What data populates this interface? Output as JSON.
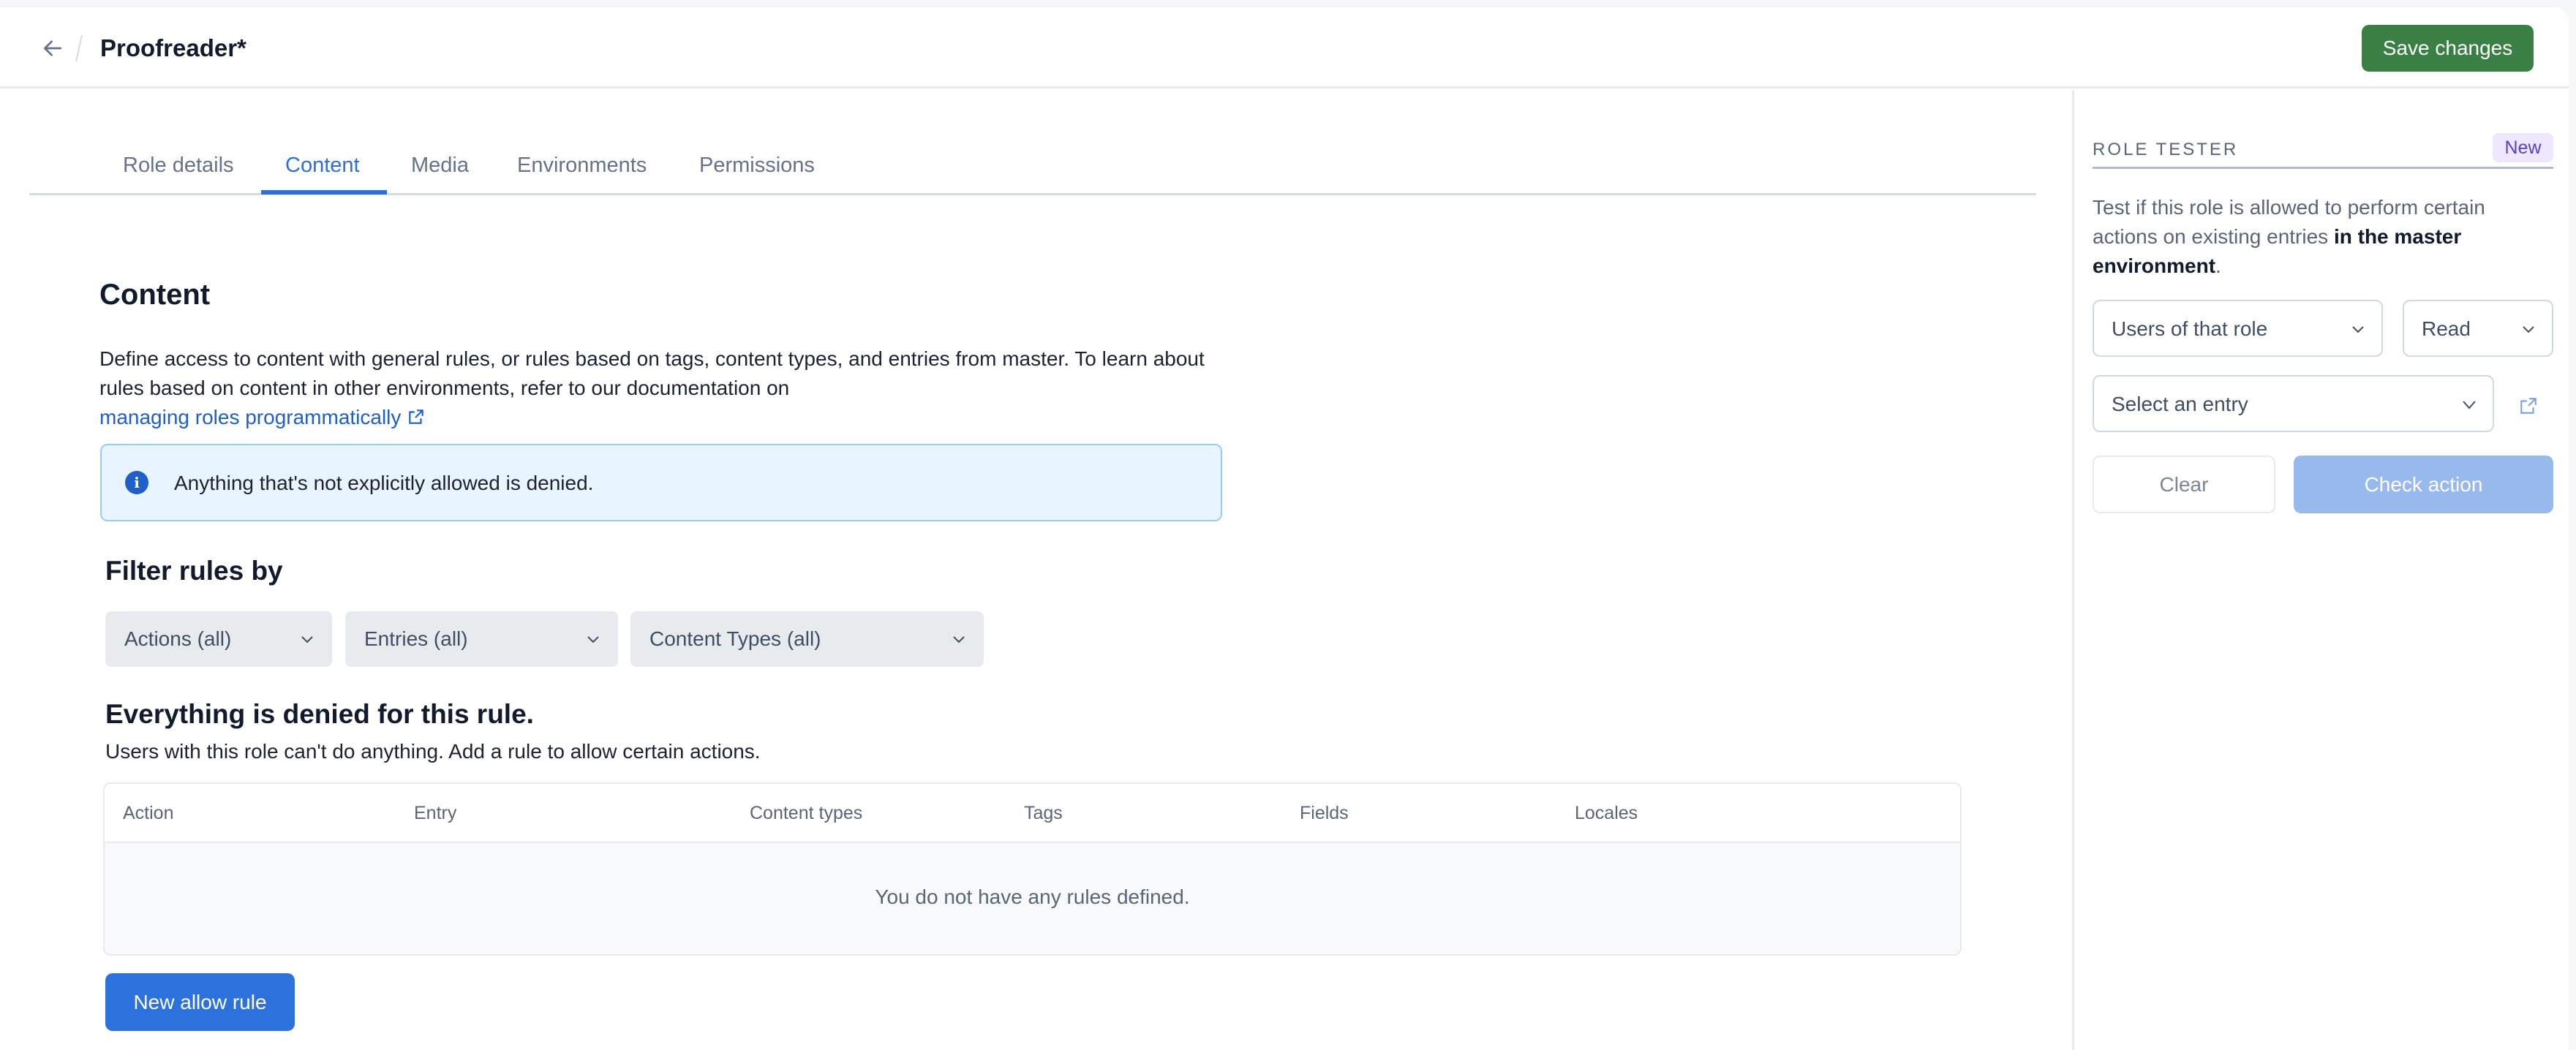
{
  "header": {
    "title": "Proofreader*",
    "back_icon": "arrow-left-icon",
    "save_label": "Save changes"
  },
  "colors": {
    "primary": "#2d72dc",
    "save": "#3a8044",
    "info_bg": "#e8f5ff",
    "badge_bg": "#ede7ff",
    "badge_text": "#5b3fc4"
  },
  "tabs": [
    {
      "label": "Role details",
      "active": false
    },
    {
      "label": "Content",
      "active": true
    },
    {
      "label": "Media",
      "active": false
    },
    {
      "label": "Environments",
      "active": false
    },
    {
      "label": "Permissions",
      "active": false
    }
  ],
  "content": {
    "heading": "Content",
    "description": "Define access to content with general rules, or rules based on tags, content types, and entries from master. To learn about rules based on content in other environments, refer to our documentation on",
    "doc_link": "managing roles programmatically",
    "info_icon": "info-icon",
    "info_text": "Anything that's not explicitly allowed is denied.",
    "filter_heading": "Filter rules by",
    "filters": [
      {
        "label": "Actions (all)"
      },
      {
        "label": "Entries (all)"
      },
      {
        "label": "Content Types (all)"
      }
    ],
    "denied_heading": "Everything is denied for this rule.",
    "denied_subtitle": "Users with this role can't do anything. Add a rule to allow certain actions.",
    "table": {
      "columns": [
        "Action",
        "Entry",
        "Content types",
        "Tags",
        "Fields",
        "Locales"
      ],
      "rows": [],
      "empty_text": "You do not have any rules defined."
    },
    "new_rule_label": "New allow rule"
  },
  "role_tester": {
    "label": "ROLE TESTER",
    "badge": "New",
    "description_plain": "Test if this role is allowed to perform certain actions on existing entries ",
    "description_bold": "in the master environment",
    "description_end": ".",
    "subject_select": "Users of that role",
    "action_select": "Read",
    "entry_select": "Select an entry",
    "clear_label": "Clear",
    "check_label": "Check action"
  }
}
